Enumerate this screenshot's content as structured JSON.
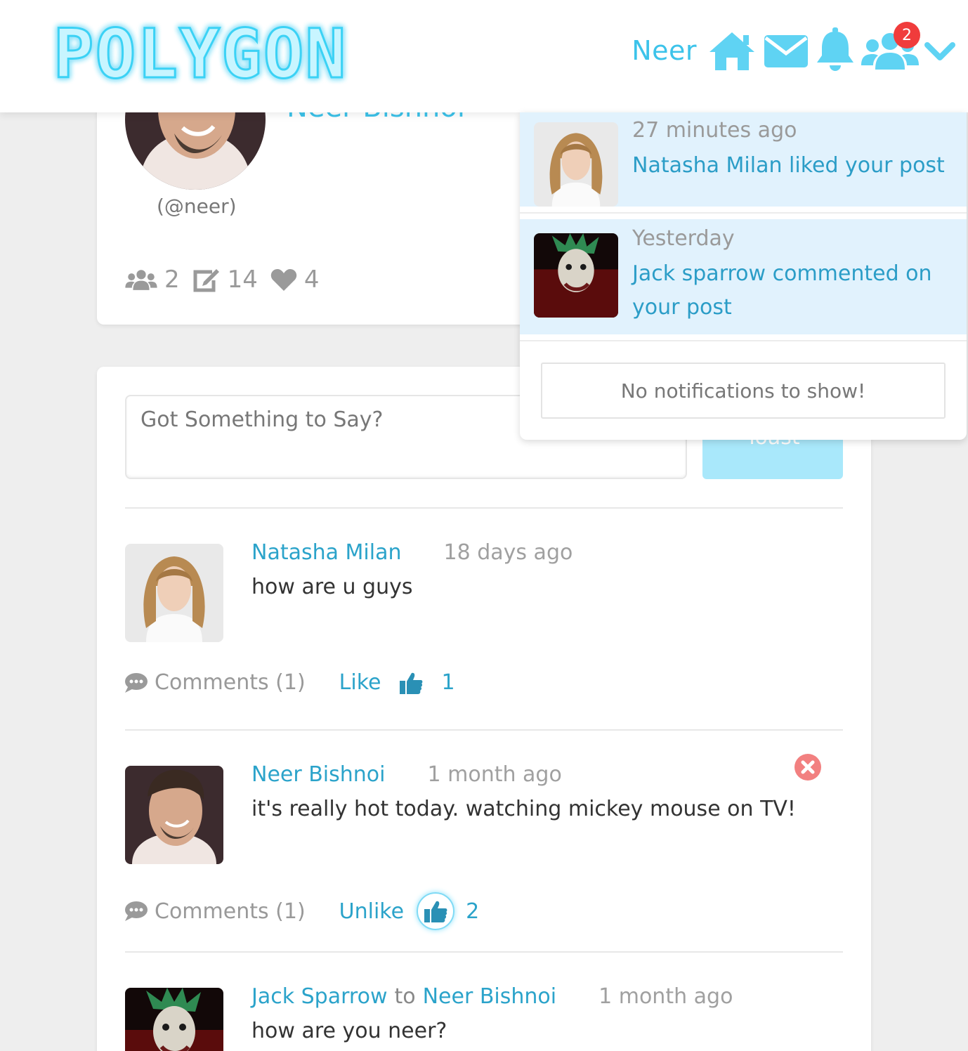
{
  "brand": {
    "logo_text": "POLYGON"
  },
  "nav": {
    "username": "Neer",
    "icons": [
      "home-icon",
      "envelope-icon",
      "bell-icon",
      "users-icon",
      "chevron-down-icon"
    ],
    "friend_requests_badge": "2",
    "accent_color": "#3cc3ea"
  },
  "profile": {
    "name": "Neer Bishnoi",
    "handle": "(@neer)",
    "stats": {
      "friends": "2",
      "posts": "14",
      "likes": "4"
    }
  },
  "composer": {
    "placeholder": "Got Something to Say?",
    "submit_label": "Toast"
  },
  "posts": [
    {
      "author": "Natasha Milan",
      "time": "18 days ago",
      "text": "how are u guys",
      "comments_label": "Comments (1)",
      "like_label": "Like",
      "like_count": "1"
    },
    {
      "author": "Neer Bishnoi",
      "time": "1 month ago",
      "text": "it's really hot today. watching mickey mouse on TV!",
      "comments_label": "Comments (1)",
      "like_label": "Unlike",
      "like_count": "2"
    },
    {
      "author": "Jack Sparrow",
      "to_word": "to",
      "recipient": "Neer Bishnoi",
      "time": "1 month ago",
      "text": "how are you neer?"
    }
  ],
  "notifications": {
    "items": [
      {
        "time": "27 minutes ago",
        "text": "Natasha Milan liked your post"
      },
      {
        "time": "Yesterday",
        "text": "Jack sparrow commented on your post"
      }
    ],
    "empty_label": "No notifications to show!"
  }
}
